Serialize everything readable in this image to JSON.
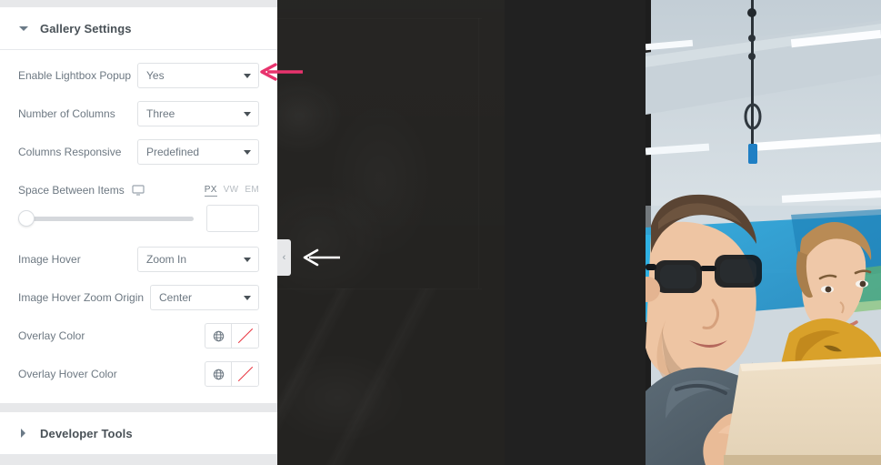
{
  "panel": {
    "sections": [
      {
        "id": "gallery-settings",
        "title": "Gallery Settings",
        "expanded_icon": "caret-down-icon"
      },
      {
        "id": "developer-tools",
        "title": "Developer Tools",
        "expanded_icon": "caret-right-icon"
      }
    ],
    "fields": {
      "enable_lightbox": {
        "label": "Enable Lightbox Popup",
        "value": "Yes"
      },
      "number_of_columns": {
        "label": "Number of Columns",
        "value": "Three"
      },
      "columns_responsive": {
        "label": "Columns Responsive",
        "value": "Predefined"
      },
      "space_between_items": {
        "label": "Space Between Items",
        "device_icon": "desktop-monitor-icon",
        "units": [
          "PX",
          "VW",
          "EM"
        ],
        "active_unit": "PX",
        "slider_value": 0,
        "input_value": "",
        "input_placeholder": ""
      },
      "image_hover": {
        "label": "Image Hover",
        "value": "Zoom In"
      },
      "image_hover_zoom_origin": {
        "label": "Image Hover Zoom Origin",
        "value": "Center"
      },
      "overlay_color": {
        "label": "Overlay Color",
        "globe_icon": "globe-icon",
        "swatch": "transparent"
      },
      "overlay_hover_color": {
        "label": "Overlay Hover Color",
        "globe_icon": "globe-icon",
        "swatch": "transparent"
      }
    },
    "collapse_handle": {
      "glyph": "‹",
      "name": "panel-collapse-handle"
    }
  },
  "annotations": {
    "pink_arrow": {
      "color": "#e8336d",
      "points_to": "enable-lightbox-select",
      "direction": "left"
    },
    "white_arrow": {
      "color": "#ffffff",
      "points_to": "panel-collapse-handle",
      "direction": "left"
    }
  },
  "colors": {
    "panel_bg": "#e7e8ea",
    "panel_surface": "#ffffff",
    "label_text": "#6d7882",
    "title_text": "#495157",
    "border": "#dfe2e5",
    "canvas_bg": "#212121",
    "swatch_slash": "#e8343f"
  }
}
